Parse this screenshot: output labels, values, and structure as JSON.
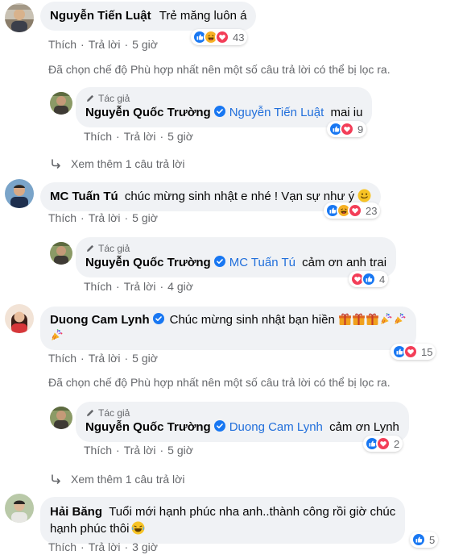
{
  "colors": {
    "like": "#1877f2",
    "love": "#f33e58",
    "haha": "#f7b125",
    "link": "#216fdb",
    "muted": "#65676b",
    "bubble": "#f0f2f5"
  },
  "labels": {
    "like": "Thích",
    "reply": "Trả lời",
    "author_tag": "Tác giả"
  },
  "filter_notice": "Đã chọn chế độ Phù hợp nhất nên một số câu trả lời có thể bị lọc ra.",
  "comments": [
    {
      "name": "Nguyễn Tiến Luật",
      "text": "Trẻ măng luôn á",
      "time": "5 giờ",
      "reactions": [
        "like-icon",
        "haha-icon",
        "love-icon"
      ],
      "count": "43"
    },
    {
      "name": "Nguyễn Quốc Trường",
      "mention": "Nguyễn Tiến Luật",
      "text": "mai iu",
      "time": "5 giờ",
      "reactions": [
        "like-icon",
        "love-icon"
      ],
      "count": "9"
    },
    {
      "more": "Xem thêm 1 câu trả lời"
    },
    {
      "name": "MC Tuấn Tú",
      "text": "chúc mừng sinh nhật e nhé ! Vạn sự như ý",
      "time": "5 giờ",
      "reactions": [
        "like-icon",
        "haha-icon",
        "love-icon"
      ],
      "count": "23"
    },
    {
      "name": "Nguyễn Quốc Trường",
      "mention": "MC Tuấn Tú",
      "text": "cảm ơn anh trai",
      "time": "4 giờ",
      "reactions": [
        "love-icon",
        "like-icon"
      ],
      "count": "4"
    },
    {
      "name": "Duong Cam Lynh",
      "text": "Chúc mừng sinh nhật bạn hiền",
      "time": "5 giờ",
      "reactions": [
        "like-icon",
        "love-icon"
      ],
      "count": "15"
    },
    {
      "name": "Nguyễn Quốc Trường",
      "mention": "Duong Cam Lynh",
      "text": "cảm ơn Lynh",
      "time": "5 giờ",
      "reactions": [
        "like-icon",
        "love-icon"
      ],
      "count": "2"
    },
    {
      "more": "Xem thêm 1 câu trả lời"
    },
    {
      "name": "Hải Băng",
      "text_line1": "Tuổi mới hạnh phúc nha anh..thành công rồi giờ chúc",
      "text_line2": "hạnh phúc thôi",
      "time": "3 giờ",
      "reactions": [
        "like-icon"
      ],
      "count": "5"
    }
  ]
}
